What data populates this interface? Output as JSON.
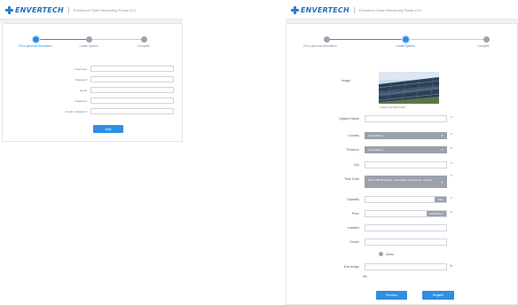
{
  "brand": {
    "logo_text": "ENVERTECH",
    "accent": "#2b8be0",
    "left_portal_title": "Envertech Smart Monitoring Portal V2.0",
    "right_portal_title": "Envertech Smart Monitoring Portal V2.0"
  },
  "left_screen": {
    "steps": [
      {
        "label": "Fill in personal information",
        "state": "active"
      },
      {
        "label": "Create System",
        "state": "inactive"
      },
      {
        "label": "Complete",
        "state": "inactive"
      }
    ],
    "fields": [
      {
        "label": "Username",
        "value": ""
      },
      {
        "label": "Password",
        "value": ""
      },
      {
        "label": "Email",
        "value": ""
      },
      {
        "label": "Password",
        "value": ""
      },
      {
        "label": "Confirm Password",
        "value": ""
      }
    ],
    "next_button": "Next"
  },
  "right_screen": {
    "steps": [
      {
        "label": "Fill in personal information",
        "state": "done"
      },
      {
        "label": "Create System",
        "state": "active"
      },
      {
        "label": "Complete",
        "state": "inactive"
      }
    ],
    "image_label": "Image",
    "image_caption": "Image size:220*140px",
    "fields": {
      "system_name": {
        "label": "System Name",
        "value": ""
      },
      "country": {
        "label": "Country",
        "value": "Unpublished"
      },
      "province": {
        "label": "Province",
        "value": "Unpublished"
      },
      "city": {
        "label": "City",
        "value": ""
      },
      "time_zone": {
        "label": "Time Zone",
        "value": "(UTC+08:00) Beijing, Chongqing, Hong Kong, Urumqi"
      },
      "capacity": {
        "label": "Capacity",
        "value": "",
        "unit": "KWp"
      },
      "price": {
        "label": "Price",
        "value": "",
        "unit": "EUR/KWh"
      },
      "installer": {
        "label": "Installer",
        "value": ""
      },
      "owner": {
        "label": "Owner",
        "value": ""
      }
    },
    "demo_label": "Demo",
    "eve_bridge": {
      "label": "Eve bridge",
      "value": ""
    },
    "sn_label": "SN",
    "previous_button": "Previous",
    "register_button": "Register"
  }
}
